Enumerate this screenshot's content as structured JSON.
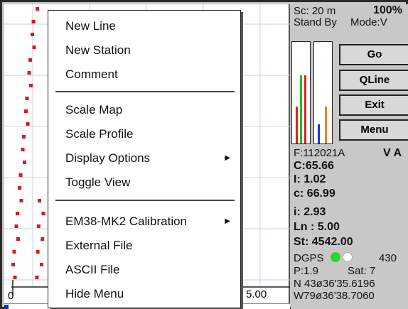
{
  "plot": {
    "axis_left": "0",
    "axis_right": "5.00"
  },
  "menu": {
    "items": [
      {
        "label": "New Line"
      },
      {
        "label": "New Station"
      },
      {
        "label": "Comment"
      },
      {
        "label": "Scale Map"
      },
      {
        "label": "Scale Profile"
      },
      {
        "label": "Display Options"
      },
      {
        "label": "Toggle View"
      },
      {
        "label": "EM38-MK2 Calibration"
      },
      {
        "label": "External File"
      },
      {
        "label": "ASCII File"
      },
      {
        "label": "Hide Menu"
      }
    ]
  },
  "panel": {
    "scale": "Sc:  20 m",
    "zoom": "100%",
    "standby": "Stand By",
    "mode": "Mode:V",
    "buttons": {
      "go": "Go",
      "qline": "QLine",
      "exit": "Exit",
      "menu": "Menu"
    },
    "file": "F:112021A",
    "file_flag": "V A",
    "c_upper": "C:65.66",
    "i_upper": "I: 1.02",
    "c_lower": "c: 66.99",
    "i_lower": "i: 2.93",
    "line": "Ln : 5.00",
    "station": "St:  4542.00",
    "dgps": "DGPS",
    "dgps_value": "430",
    "p_value": "P:1.9",
    "sat": "Sat:  7",
    "lat": "N 43ø36'35.6196",
    "lon": "W79ø36'38.7060"
  },
  "colors": {
    "profile_dots": "#e01818",
    "gps_green": "#22dd22",
    "gps_white": "#ffffff",
    "bar_red": "#e02020",
    "bar_green": "#20c020",
    "bar_blue": "#2030e0",
    "bar_orange": "#f08020"
  }
}
